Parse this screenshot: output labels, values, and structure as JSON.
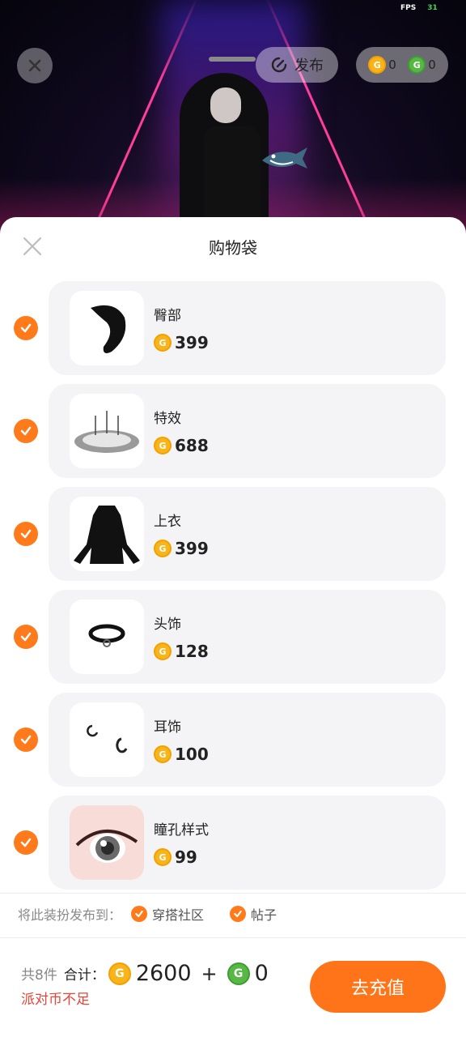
{
  "status": {
    "fps_label": "FPS",
    "fps_value": "31"
  },
  "top_bar": {
    "publish_label": "发布",
    "wallet": {
      "orange_coin_balance": "0",
      "green_coin_balance": "0"
    }
  },
  "sheet": {
    "title": "购物袋",
    "items": [
      {
        "name": "臀部",
        "price": "399",
        "thumb": "tail-icon",
        "checked": true
      },
      {
        "name": "特效",
        "price": "688",
        "thumb": "effect-ring-icon",
        "checked": true
      },
      {
        "name": "上衣",
        "price": "399",
        "thumb": "dress-icon",
        "checked": true
      },
      {
        "name": "头饰",
        "price": "128",
        "thumb": "collar-icon",
        "checked": true
      },
      {
        "name": "耳饰",
        "price": "100",
        "thumb": "earring-icon",
        "checked": true
      },
      {
        "name": "瞳孔样式",
        "price": "99",
        "thumb": "eye-icon",
        "checked": true
      }
    ],
    "publish_to": {
      "label": "将此装扮发布到：",
      "options": [
        {
          "label": "穿搭社区",
          "checked": true
        },
        {
          "label": "帖子",
          "checked": true
        }
      ]
    },
    "footer": {
      "count_label": "共8件",
      "total_label": "合计：",
      "orange_total": "2600",
      "plus": "+",
      "green_total": "0",
      "warning": "派对币不足",
      "recharge_label": "去充值"
    }
  },
  "colors": {
    "accent": "#ff7418",
    "warning": "#e8443a",
    "coin_orange": "#f7b51b",
    "coin_green": "#59b845",
    "card_bg": "#f4f4f6"
  }
}
